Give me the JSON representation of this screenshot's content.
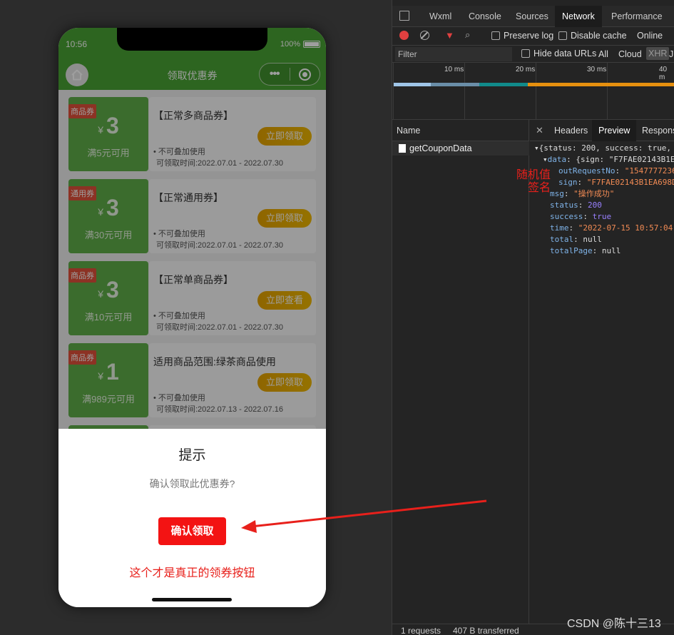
{
  "phone": {
    "time": "10:56",
    "battery": "100%",
    "nav_title": "领取优惠券",
    "capsule_menu": "•••",
    "coupons": [
      {
        "tag": "商品券",
        "yen": "¥",
        "amount": "3",
        "condition": "满5元可用",
        "title": "【正常多商品券】",
        "button": "立即领取",
        "note": "• 不可叠加使用",
        "period": "可领取时间:2022.07.01 - 2022.07.30"
      },
      {
        "tag": "通用券",
        "yen": "¥",
        "amount": "3",
        "condition": "满30元可用",
        "title": "【正常通用券】",
        "button": "立即领取",
        "note": "• 不可叠加使用",
        "period": "可领取时间:2022.07.01 - 2022.07.30"
      },
      {
        "tag": "商品券",
        "yen": "¥",
        "amount": "3",
        "condition": "满10元可用",
        "title": "【正常单商品券】",
        "button": "立即查看",
        "note": "• 不可叠加使用",
        "period": "可领取时间:2022.07.01 - 2022.07.30"
      },
      {
        "tag": "商品券",
        "yen": "¥",
        "amount": "1",
        "condition": "满989元可用",
        "title": "适用商品范围:绿茶商品使用",
        "button": "立即领取",
        "note": "• 不可叠加使用",
        "period": "可领取时间:2022.07.13 - 2022.07.16"
      }
    ],
    "modal": {
      "title": "提示",
      "content": "确认领取此优惠券?",
      "confirm": "确认领取",
      "annotation": "这个才是真正的领券按钮"
    }
  },
  "devtools": {
    "tabs": [
      "Wxml",
      "Console",
      "Sources",
      "Network",
      "Performance"
    ],
    "active_tab": "Network",
    "toolbar": {
      "preserve_log": "Preserve log",
      "disable_cache": "Disable cache",
      "throttle": "Online"
    },
    "filter": {
      "placeholder": "Filter",
      "hide_data_urls": "Hide data URLs",
      "all": "All",
      "cloud": "Cloud",
      "xhr": "XHR",
      "j": "J"
    },
    "timeline_ticks": [
      "10 ms",
      "20 ms",
      "30 ms",
      "40 m"
    ],
    "name_header": "Name",
    "request_name": "getCouponData",
    "detail_tabs": {
      "headers": "Headers",
      "preview": "Preview",
      "response": "Response"
    },
    "json_lines": {
      "root": "{status: 200, success: true,",
      "data_key": "data",
      "data_val": ": {sign: \"F7FAE02143B1E",
      "out_key": "outRequestNo",
      "out_val": "\"1547777236",
      "sign_key": "sign",
      "sign_val": "\"F7FAE02143B1EA698D",
      "msg_key": "msg",
      "msg_val": "\"操作成功\"",
      "status_key": "status",
      "status_val": "200",
      "success_key": "success",
      "success_val": "true",
      "time_key": "time",
      "time_val": "\"2022-07-15 10:57:04\"",
      "total_key": "total",
      "total_val": "null",
      "totalpage_key": "totalPage",
      "totalpage_val": "null"
    },
    "annotations": {
      "random": "随机值",
      "sign": "签名"
    },
    "footer": {
      "requests": "1 requests",
      "transferred": "407 B transferred"
    }
  },
  "watermark": "CSDN @陈十三13",
  "colors": {
    "brand_green": "#4aa334",
    "confirm_red": "#f31313",
    "annotation_red": "#e8201b",
    "coupon_gold": "#e6a400"
  }
}
